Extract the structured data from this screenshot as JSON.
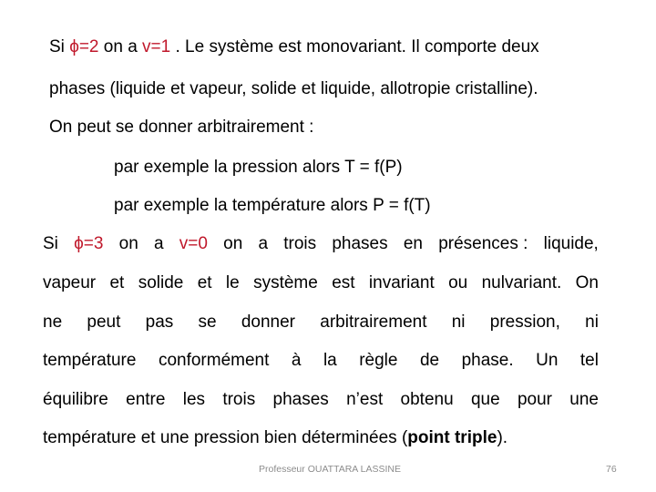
{
  "paragraph1": {
    "line1": {
      "prefix": "Si ",
      "phi": "ϕ=2",
      "mid": " on a ",
      "v": "v=1",
      "suffix": " . Le système est monovariant. Il comporte deux"
    },
    "line2": "phases (liquide et vapeur, solide et liquide, allotropie cristalline).",
    "line3": "On peut se donner arbitrairement :",
    "example1": "par exemple la pression alors T = f(P)",
    "example2": "par exemple la température alors P = f(T)"
  },
  "paragraph2": {
    "line1": {
      "si": "Si",
      "phi": "ϕ=3",
      "words_a": [
        "on",
        "a"
      ],
      "v": "v=0",
      "words_b": [
        "on",
        "a",
        "trois",
        "phases",
        "en",
        "présences :",
        "liquide,"
      ]
    },
    "line2": [
      "vapeur",
      "et",
      "solide",
      "et",
      "le",
      "système",
      "est",
      "invariant",
      "ou",
      "nulvariant.",
      "On"
    ],
    "line3": [
      "ne",
      "peut",
      "pas",
      "se",
      "donner",
      "arbitrairement",
      "ni",
      "pression,",
      "ni"
    ],
    "line4": [
      "température",
      "conformément",
      "à",
      "la",
      "règle",
      "de",
      "phase.",
      "Un",
      "tel"
    ],
    "line5": [
      "équilibre",
      "entre",
      "les",
      "trois",
      "phases",
      "n’est",
      "obtenu",
      "que",
      "pour",
      "une"
    ],
    "line6": {
      "text": "température et une pression bien déterminées (",
      "bold": "point triple",
      "end": ")."
    }
  },
  "footer": {
    "author": "Professeur OUATTARA LASSINE",
    "page_number": "76"
  },
  "colors": {
    "accent_red": "#c0182b",
    "footer_gray": "#8c8c8c"
  }
}
